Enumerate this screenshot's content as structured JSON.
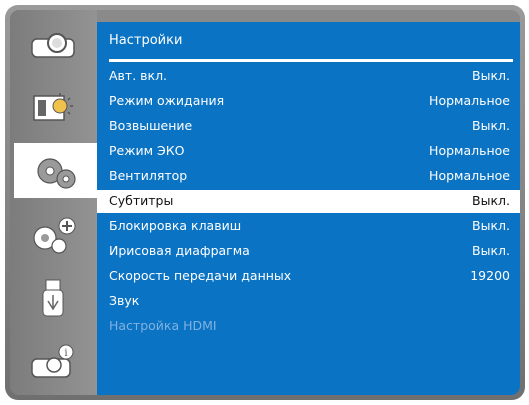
{
  "sidebar": {
    "items": [
      {
        "name": "projector-icon"
      },
      {
        "name": "picture-adjust-icon"
      },
      {
        "name": "settings-gears-icon"
      },
      {
        "name": "extended-settings-icon"
      },
      {
        "name": "usb-icon"
      },
      {
        "name": "info-icon"
      }
    ]
  },
  "panel": {
    "title": "Настройки",
    "rows": [
      {
        "label": "Авт. вкл.",
        "value": "Выкл."
      },
      {
        "label": "Режим ожидания",
        "value": "Нормальное"
      },
      {
        "label": "Возвышение",
        "value": "Выкл."
      },
      {
        "label": "Режим ЭКО",
        "value": "Нормальное"
      },
      {
        "label": "Вентилятор",
        "value": "Нормальное"
      },
      {
        "label": "Субтитры",
        "value": "Выкл."
      },
      {
        "label": "Блокировка клавиш",
        "value": "Выкл."
      },
      {
        "label": "Ирисовая диафрагма",
        "value": "Выкл."
      },
      {
        "label": "Скорость передачи данных",
        "value": "19200"
      },
      {
        "label": "Звук",
        "value": ""
      },
      {
        "label": "Настройка HDMI",
        "value": ""
      }
    ]
  },
  "colors": {
    "panel_bg": "#0b73c4",
    "selected_bg": "#ffffff",
    "disabled_text": "#7fb2df"
  }
}
